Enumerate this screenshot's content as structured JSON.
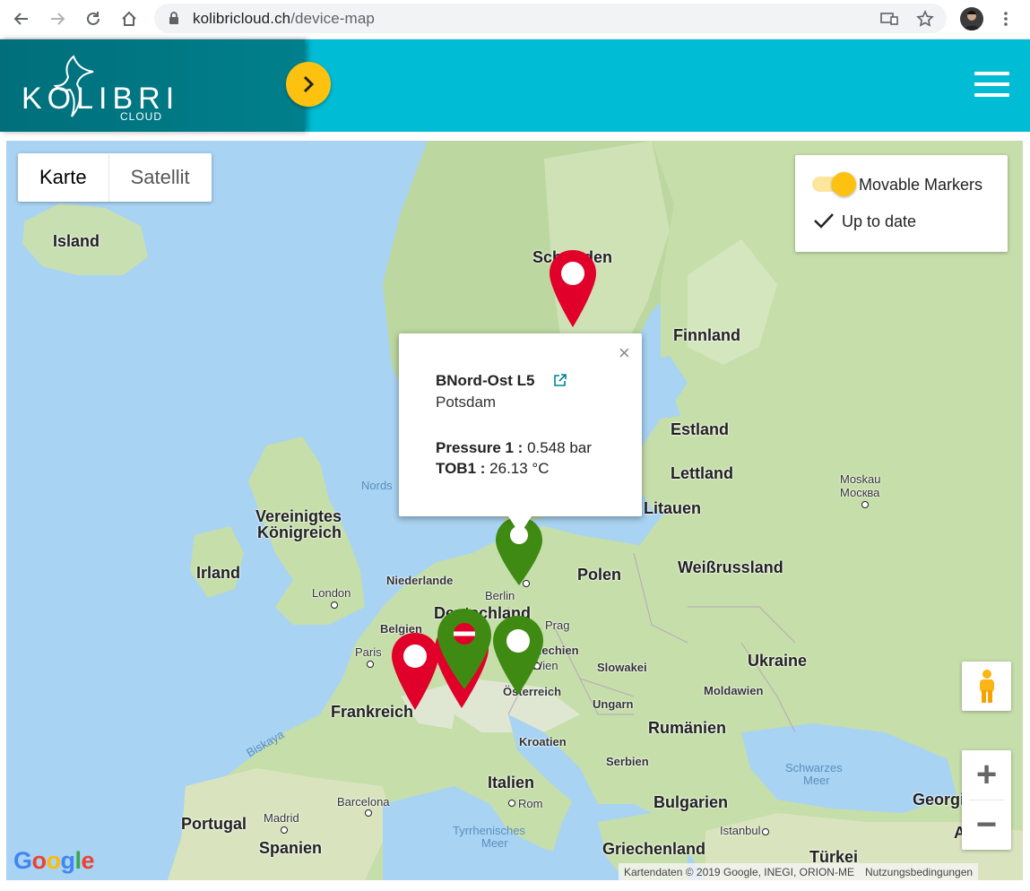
{
  "browser": {
    "url_host": "kolibricloud.ch",
    "url_path": "/device-map"
  },
  "app": {
    "logo_text": "KOLIBRI",
    "logo_sub": "CLOUD"
  },
  "map": {
    "type_tabs": [
      "Karte",
      "Satellit"
    ],
    "controls": {
      "movable_markers_label": "Movable Markers",
      "up_to_date_label": "Up to date"
    },
    "labels": {
      "island": "Island",
      "schweden": "Schweden",
      "finnland": "Finnland",
      "estland": "Estland",
      "lettland": "Lettland",
      "litauen": "Litauen",
      "moskau": "Moskau",
      "moskva": "Москва",
      "vereinigtes1": "Vereinigtes",
      "vereinigtes2": "Königreich",
      "irland": "Irland",
      "london": "London",
      "niederlande": "Niederlande",
      "berlin": "Berlin",
      "polen": "Polen",
      "weissrussland": "Weißrussland",
      "deutschland": "Deutschland",
      "belgien": "Belgien",
      "prag": "Prag",
      "tschechien": "Tschechien",
      "paris": "Paris",
      "wien": "Wien",
      "slowakei": "Slowakei",
      "ukraine": "Ukraine",
      "oesterreich": "Österreich",
      "ungarn": "Ungarn",
      "moldawien": "Moldawien",
      "frankreich": "Frankreich",
      "biskaya": "Biskaya",
      "rumaenien": "Rumänien",
      "kroatien": "Kroatien",
      "serbien": "Serbien",
      "schwarzes1": "Schwarzes",
      "schwarzes2": "Meer",
      "italien": "Italien",
      "barcelona": "Barcelona",
      "rom": "Rom",
      "bulgarien": "Bulgarien",
      "georgien": "Georgi",
      "portugal": "Portugal",
      "madrid": "Madrid",
      "spanien": "Spanien",
      "tyrrhen1": "Tyrrhenisches",
      "tyrrhen2": "Meer",
      "griechenland": "Griechenland",
      "istanbul": "Istanbul",
      "tuerkei": "Türkei",
      "nordsee": "Nords",
      "a_label": "A"
    },
    "google_logo": "Google",
    "attribution": "Kartendaten © 2019 Google, INEGI, ORION-ME",
    "terms": "Nutzungsbedingungen",
    "zoom_in": "+",
    "zoom_out": "−"
  },
  "infowindow": {
    "title": "BNord-Ost L5",
    "city": "Potsdam",
    "pressure_label": "Pressure 1 :",
    "pressure_value": "0.548 bar",
    "tob_label": "TOB1 :",
    "tob_value": "26.13 °C",
    "close": "×"
  },
  "colors": {
    "appbar": "#00bcd4",
    "accent": "#fdc20f",
    "marker_red": "#e0002a",
    "marker_green": "#3f8a12"
  }
}
